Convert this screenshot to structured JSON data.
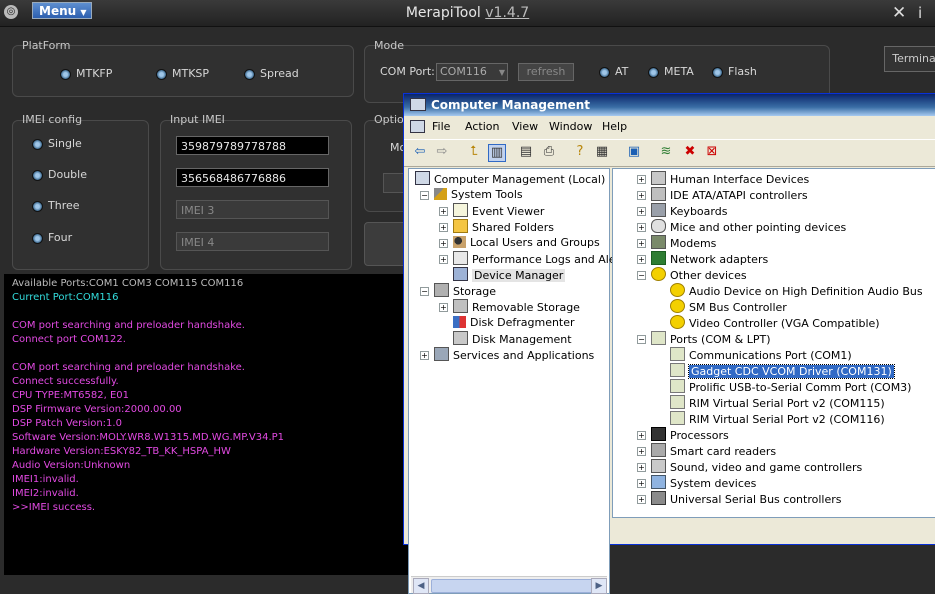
{
  "app": {
    "title": "MerapiTool",
    "version": "v1.4.7",
    "menu_label": "Menu",
    "close_glyph": "✕",
    "info_glyph": "i"
  },
  "platform": {
    "title": "PlatForm",
    "options": [
      "MTKFP",
      "MTKSP",
      "Spread"
    ]
  },
  "mode": {
    "title": "Mode",
    "com_port_label": "COM Port:",
    "com_port_value": "COM116",
    "refresh_label": "refresh",
    "options": [
      "AT",
      "META",
      "Flash"
    ],
    "terminal_label": "Termina"
  },
  "imei_config": {
    "title": "IMEI config",
    "options": [
      "Single",
      "Double",
      "Three",
      "Four"
    ]
  },
  "input_imei": {
    "title": "Input IMEI",
    "imei1": "359879789778788",
    "imei2": "356568486776886",
    "placeholder3": "IMEI 3",
    "placeholder4": "IMEI 4"
  },
  "option": {
    "title": "Option",
    "label": "Mo"
  },
  "console": {
    "lines": [
      {
        "text": "Available Ports:COM1 COM3 COM115 COM116",
        "color": "gray"
      },
      {
        "text": "Current Port:COM116",
        "color": "cyan"
      },
      {
        "text": "",
        "color": "gray"
      },
      {
        "text": "COM port searching and preloader handshake.",
        "color": "mag"
      },
      {
        "text": "Connect port COM122.",
        "color": "mag"
      },
      {
        "text": "",
        "color": "gray"
      },
      {
        "text": "COM port searching and preloader handshake.",
        "color": "mag"
      },
      {
        "text": "Connect successfully.",
        "color": "mag"
      },
      {
        "text": "CPU TYPE:MT6582, E01",
        "color": "mag"
      },
      {
        "text": "DSP Firmware Version:2000.00.00",
        "color": "mag"
      },
      {
        "text": "DSP Patch Version:1.0",
        "color": "mag"
      },
      {
        "text": "Software Version:MOLY.WR8.W1315.MD.WG.MP.V34.P1",
        "color": "mag"
      },
      {
        "text": "Hardware Version:ESKY82_TB_KK_HSPA_HW",
        "color": "mag"
      },
      {
        "text": "Audio Version:Unknown",
        "color": "mag"
      },
      {
        "text": "IMEI1:invalid.",
        "color": "mag"
      },
      {
        "text": "IMEI2:invalid.",
        "color": "mag"
      },
      {
        "text": ">>IMEI success.",
        "color": "mag"
      }
    ]
  },
  "cm": {
    "title": "Computer Management",
    "menu": [
      "File",
      "Action",
      "View",
      "Window",
      "Help"
    ],
    "left_tree": [
      {
        "label": "Computer Management (Local)",
        "level": 0,
        "exp": "",
        "icon": "computer-icon"
      },
      {
        "label": "System Tools",
        "level": 1,
        "exp": "-",
        "icon": "tools-icon"
      },
      {
        "label": "Event Viewer",
        "level": 2,
        "exp": "+",
        "icon": "event-viewer-icon"
      },
      {
        "label": "Shared Folders",
        "level": 2,
        "exp": "+",
        "icon": "folder-icon"
      },
      {
        "label": "Local Users and Groups",
        "level": 2,
        "exp": "+",
        "icon": "users-icon"
      },
      {
        "label": "Performance Logs and Alerts",
        "level": 2,
        "exp": "+",
        "icon": "performance-icon"
      },
      {
        "label": "Device Manager",
        "level": 2,
        "exp": "",
        "icon": "device-manager-icon",
        "state": "hl"
      },
      {
        "label": "Storage",
        "level": 1,
        "exp": "-",
        "icon": "storage-icon"
      },
      {
        "label": "Removable Storage",
        "level": 2,
        "exp": "+",
        "icon": "removable-icon"
      },
      {
        "label": "Disk Defragmenter",
        "level": 2,
        "exp": "",
        "icon": "defrag-icon"
      },
      {
        "label": "Disk Management",
        "level": 2,
        "exp": "",
        "icon": "disk-icon"
      },
      {
        "label": "Services and Applications",
        "level": 1,
        "exp": "+",
        "icon": "services-icon"
      }
    ],
    "devices": [
      {
        "label": "Human Interface Devices",
        "level": 0,
        "exp": "+",
        "icon": "hid-icon"
      },
      {
        "label": "IDE ATA/ATAPI controllers",
        "level": 0,
        "exp": "+",
        "icon": "ide-icon"
      },
      {
        "label": "Keyboards",
        "level": 0,
        "exp": "+",
        "icon": "keyboard-icon"
      },
      {
        "label": "Mice and other pointing devices",
        "level": 0,
        "exp": "+",
        "icon": "mouse-icon"
      },
      {
        "label": "Modems",
        "level": 0,
        "exp": "+",
        "icon": "modem-icon"
      },
      {
        "label": "Network adapters",
        "level": 0,
        "exp": "+",
        "icon": "network-icon"
      },
      {
        "label": "Other devices",
        "level": 0,
        "exp": "-",
        "icon": "unknown-device-icon"
      },
      {
        "label": "Audio Device on High Definition Audio Bus",
        "level": 1,
        "exp": "",
        "icon": "unknown-device-icon"
      },
      {
        "label": "SM Bus Controller",
        "level": 1,
        "exp": "",
        "icon": "unknown-device-icon"
      },
      {
        "label": "Video Controller (VGA Compatible)",
        "level": 1,
        "exp": "",
        "icon": "unknown-device-icon"
      },
      {
        "label": "Ports (COM & LPT)",
        "level": 0,
        "exp": "-",
        "icon": "port-icon"
      },
      {
        "label": "Communications Port (COM1)",
        "level": 1,
        "exp": "",
        "icon": "port-icon"
      },
      {
        "label": "Gadget CDC VCOM Driver (COM131)",
        "level": 1,
        "exp": "",
        "icon": "port-icon",
        "state": "sel"
      },
      {
        "label": "Prolific USB-to-Serial Comm Port (COM3)",
        "level": 1,
        "exp": "",
        "icon": "port-icon"
      },
      {
        "label": "RIM Virtual Serial Port v2 (COM115)",
        "level": 1,
        "exp": "",
        "icon": "port-icon"
      },
      {
        "label": "RIM Virtual Serial Port v2 (COM116)",
        "level": 1,
        "exp": "",
        "icon": "port-icon"
      },
      {
        "label": "Processors",
        "level": 0,
        "exp": "+",
        "icon": "processor-icon"
      },
      {
        "label": "Smart card readers",
        "level": 0,
        "exp": "+",
        "icon": "smartcard-icon"
      },
      {
        "label": "Sound, video and game controllers",
        "level": 0,
        "exp": "+",
        "icon": "sound-icon"
      },
      {
        "label": "System devices",
        "level": 0,
        "exp": "+",
        "icon": "system-device-icon"
      },
      {
        "label": "Universal Serial Bus controllers",
        "level": 0,
        "exp": "+",
        "icon": "usb-icon"
      }
    ]
  }
}
